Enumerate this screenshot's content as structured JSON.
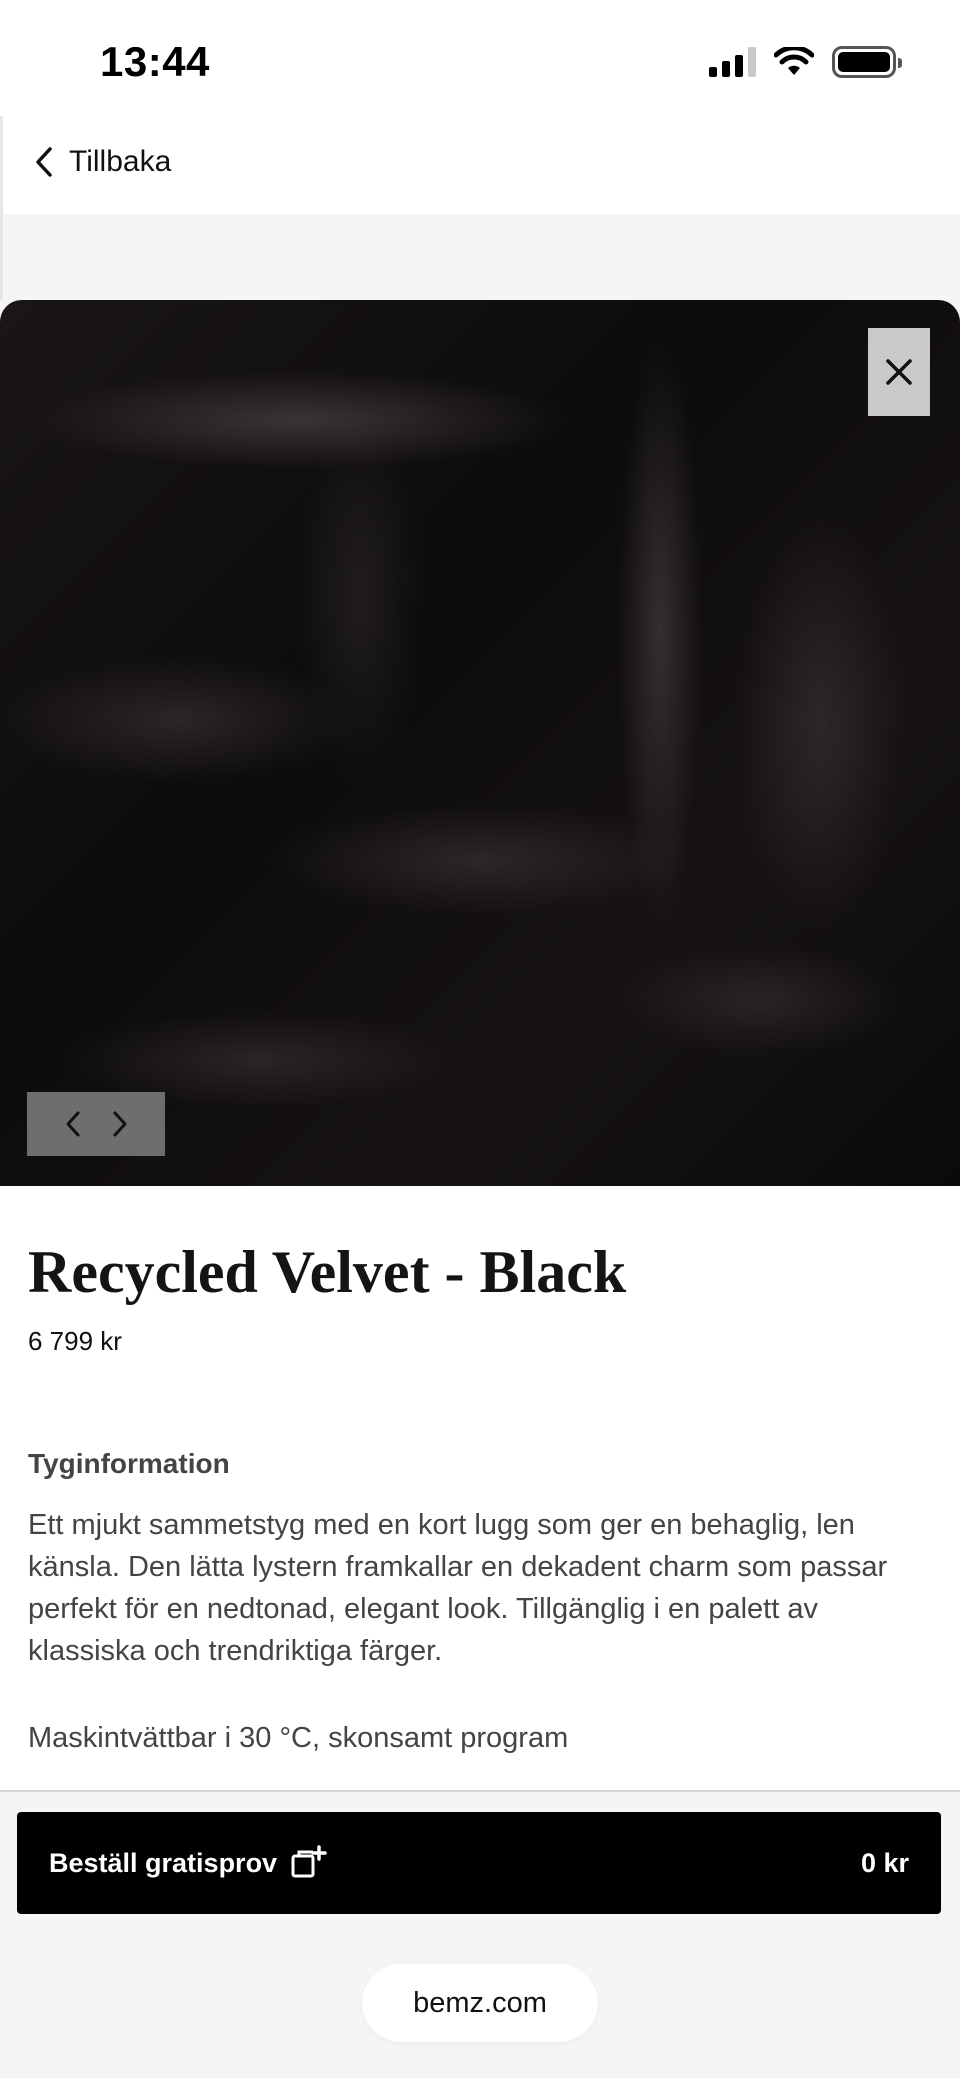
{
  "status_bar": {
    "time": "13:44",
    "icons": [
      "signal-icon",
      "wifi-icon",
      "battery-icon"
    ]
  },
  "header": {
    "back_label": "Tillbaka",
    "back_icon": "chevron-left-icon"
  },
  "gallery": {
    "close_icon": "close-icon",
    "prev_icon": "chevron-left-icon",
    "next_icon": "chevron-right-icon"
  },
  "product": {
    "title": "Recycled Velvet - Black",
    "price": "6 799 kr",
    "info_heading": "Tyginformation",
    "description": "Ett mjukt sammetstyg med en kort lugg som ger en behaglig, len känsla. Den lätta lystern framkallar en dekadent charm som passar perfekt för en nedtonad, elegant look. Tillgänglig i en palett av klassiska och trendriktiga färger.",
    "care": "Maskintvättbar i 30 °C, skonsamt program"
  },
  "order": {
    "label": "Beställ gratisprov",
    "icon": "add-sample-icon",
    "price": "0 kr"
  },
  "browser": {
    "domain": "bemz.com"
  },
  "colors": {
    "background": "#f5f5f4",
    "button": "#000000",
    "text": "#444444"
  }
}
